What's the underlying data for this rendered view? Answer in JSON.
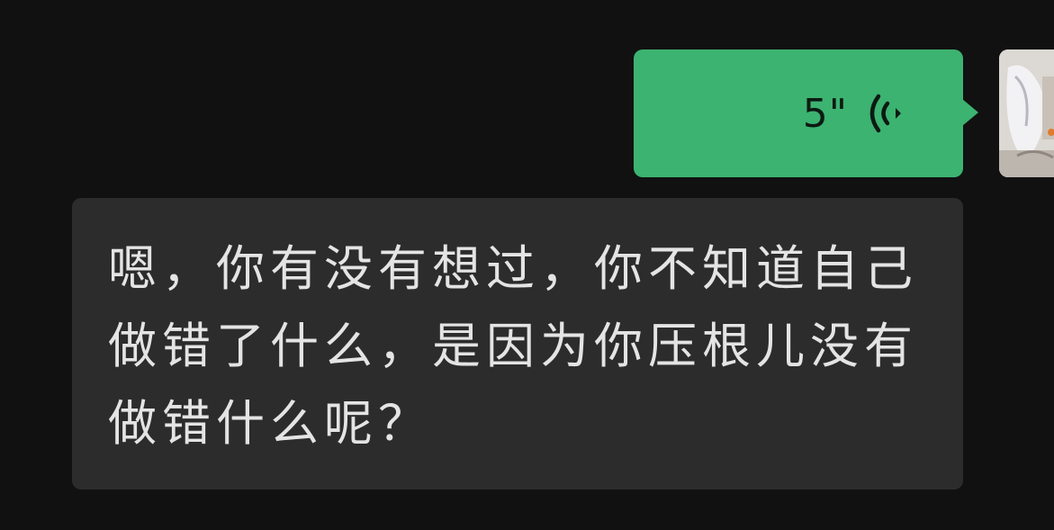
{
  "outgoing_voice": {
    "duration": "5\"",
    "icon": "voice-wave-icon",
    "bubble_color": "#3cb371"
  },
  "avatar": {
    "icon": "user-avatar-photo"
  },
  "incoming_message": {
    "text": "嗯，你有没有想过，你不知道自己做错了什么，是因为你压根儿没有做错什么呢？",
    "bubble_color": "#2c2c2c"
  }
}
